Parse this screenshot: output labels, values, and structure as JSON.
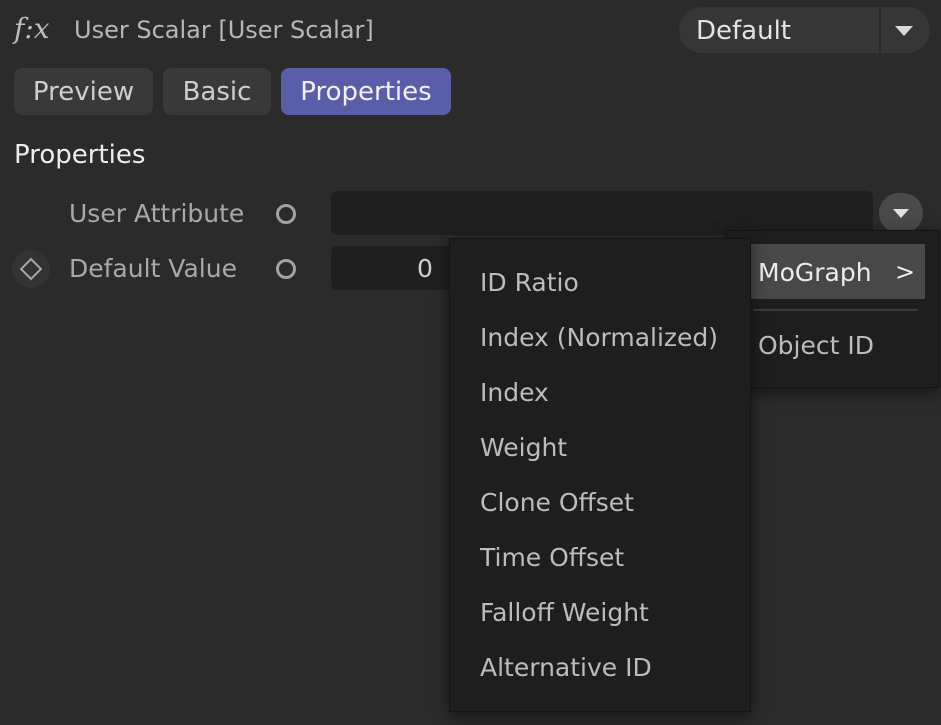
{
  "header": {
    "icon": "f:x",
    "title": "User Scalar [User Scalar]",
    "preset_value": "Default"
  },
  "tabs": [
    {
      "label": "Preview",
      "active": false
    },
    {
      "label": "Basic",
      "active": false
    },
    {
      "label": "Properties",
      "active": true
    }
  ],
  "section_title": "Properties",
  "rows": {
    "user_attribute": {
      "label": "User Attribute",
      "value": ""
    },
    "default_value": {
      "label": "Default Value",
      "value": "0"
    }
  },
  "submenu": {
    "highlighted": "MoGraph",
    "chevron": ">",
    "second_item": "Object ID"
  },
  "menu_items": [
    "ID Ratio",
    "Index (Normalized)",
    "Index",
    "Weight",
    "Clone Offset",
    "Time Offset",
    "Falloff Weight",
    "Alternative ID"
  ],
  "colors": {
    "background": "#2b2b2b",
    "active_tab": "#5a5da8",
    "menu_bg": "#1e1e1e"
  }
}
